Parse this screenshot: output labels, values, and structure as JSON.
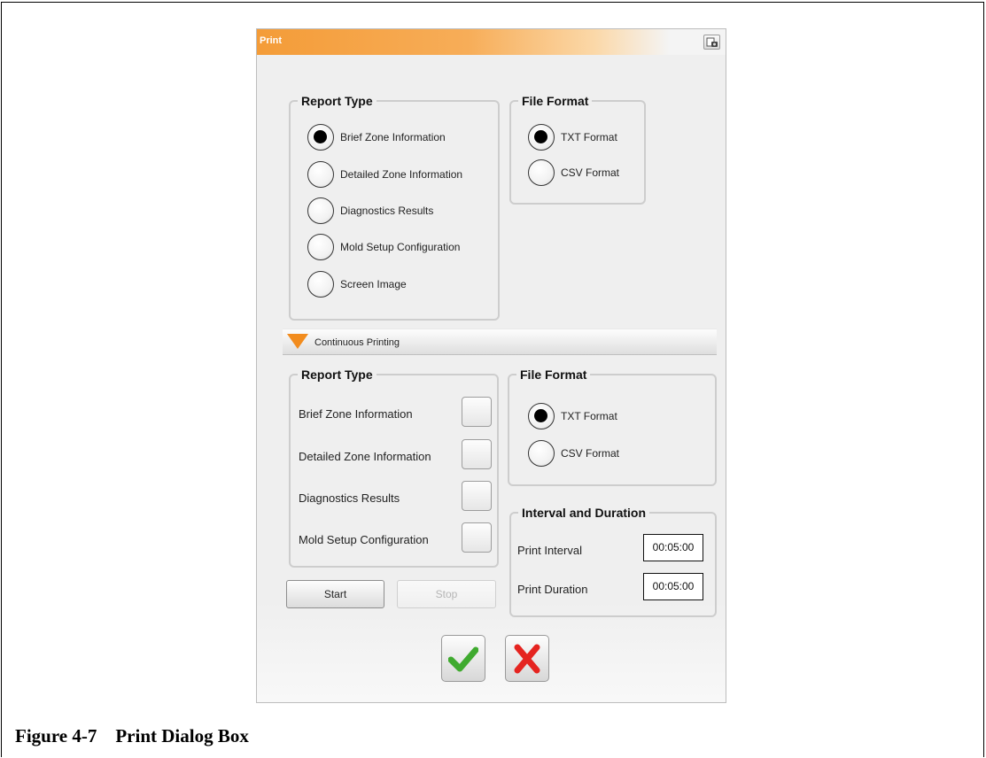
{
  "dialog": {
    "title": "Print",
    "report_type": {
      "legend": "Report Type",
      "options": [
        {
          "label": "Brief Zone Information",
          "selected": true
        },
        {
          "label": "Detailed Zone Information",
          "selected": false
        },
        {
          "label": "Diagnostics Results",
          "selected": false
        },
        {
          "label": "Mold Setup Configuration",
          "selected": false
        },
        {
          "label": "Screen Image",
          "selected": false
        }
      ]
    },
    "file_format": {
      "legend": "File Format",
      "options": [
        {
          "label": "TXT Format",
          "selected": true
        },
        {
          "label": "CSV Format",
          "selected": false
        }
      ]
    },
    "continuous": {
      "section_label": "Continuous Printing",
      "report_type": {
        "legend": "Report Type",
        "items": [
          {
            "label": "Brief Zone Information",
            "checked": false
          },
          {
            "label": "Detailed Zone Information",
            "checked": false
          },
          {
            "label": "Diagnostics Results",
            "checked": false
          },
          {
            "label": "Mold Setup Configuration",
            "checked": false
          }
        ]
      },
      "file_format": {
        "legend": "File Format",
        "options": [
          {
            "label": "TXT Format",
            "selected": true
          },
          {
            "label": "CSV Format",
            "selected": false
          }
        ]
      },
      "interval": {
        "legend": "Interval and Duration",
        "print_interval_label": "Print Interval",
        "print_interval_value": "00:05:00",
        "print_duration_label": "Print Duration",
        "print_duration_value": "00:05:00"
      },
      "start_label": "Start",
      "stop_label": "Stop"
    },
    "icons": {
      "title_button": "camera-icon",
      "section_toggle": "triangle-down-icon",
      "ok": "checkmark-icon",
      "cancel": "x-icon"
    },
    "colors": {
      "accent": "#f49c38",
      "ok_green": "#3faa2f",
      "cancel_red": "#e52420"
    }
  },
  "caption": "Figure 4-7    Print Dialog Box"
}
